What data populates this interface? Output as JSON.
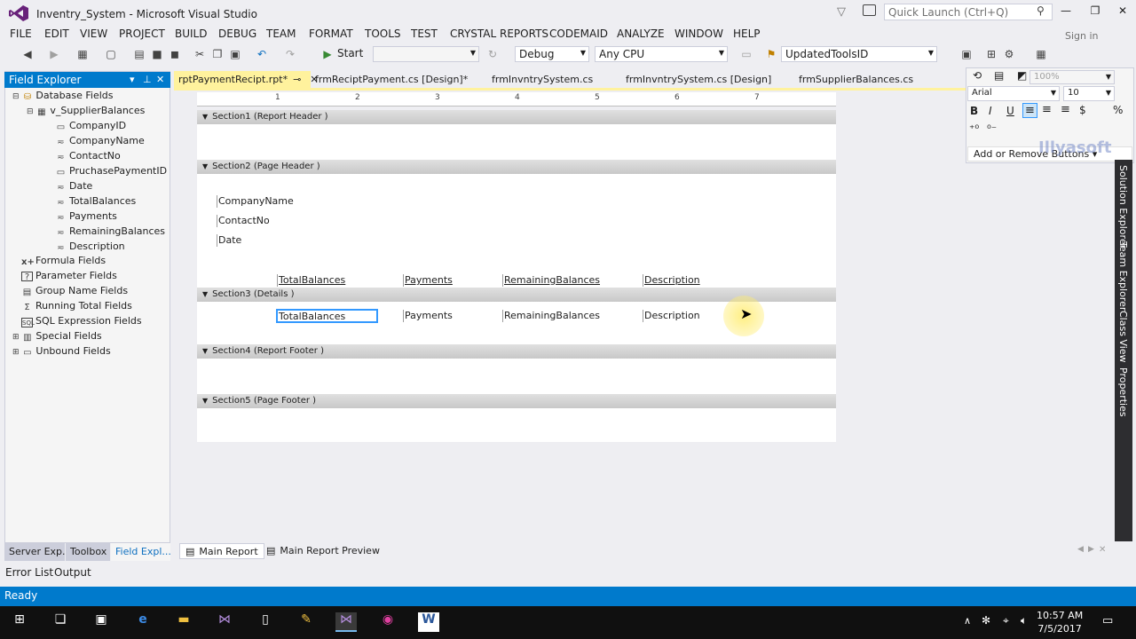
{
  "window": {
    "title": "Inventry_System - Microsoft Visual Studio",
    "quick_launch_placeholder": "Quick Launch (Ctrl+Q)"
  },
  "menu": [
    "FILE",
    "EDIT",
    "VIEW",
    "PROJECT",
    "BUILD",
    "DEBUG",
    "TEAM",
    "FORMAT",
    "TOOLS",
    "TEST",
    "CRYSTAL REPORTS",
    "CODEMAID",
    "ANALYZE",
    "WINDOW",
    "HELP"
  ],
  "toolbar": {
    "start_label": "Start",
    "config": "Debug",
    "platform": "Any CPU",
    "find_combo": "UpdatedToolsID"
  },
  "field_explorer": {
    "title": "Field Explorer",
    "database_fields": "Database Fields",
    "table": "v_SupplierBalances",
    "columns": [
      "CompanyID",
      "CompanyName",
      "ContactNo",
      "PruchasePaymentID",
      "Date",
      "TotalBalances",
      "Payments",
      "RemainingBalances",
      "Description"
    ],
    "groups": [
      "Formula Fields",
      "Parameter Fields",
      "Group Name Fields",
      "Running Total Fields",
      "SQL Expression Fields",
      "Special Fields",
      "Unbound Fields"
    ]
  },
  "left_tabs": [
    "Server Exp...",
    "Toolbox",
    "Field Expl..."
  ],
  "doc_tabs": [
    "rptPaymentRecipt.rpt*",
    "frmReciptPayment.cs [Design]*",
    "frmInvntrySystem.cs",
    "frmInvntrySystem.cs [Design]",
    "frmSupplierBalances.cs"
  ],
  "ruler_numbers": [
    "1",
    "2",
    "3",
    "4",
    "5",
    "6",
    "7"
  ],
  "sections": {
    "s1": "Section1 (Report Header )",
    "s2": "Section2 (Page Header )",
    "s3": "Section3 (Details )",
    "s4": "Section4 (Report Footer )",
    "s5": "Section5 (Page Footer )"
  },
  "page_header_fields": [
    "CompanyName",
    "ContactNo",
    "Date"
  ],
  "header_labels": [
    "TotalBalances",
    "Payments",
    "RemainingBalances",
    "Description"
  ],
  "detail_fields": [
    "TotalBalances",
    "Payments",
    "RemainingBalances",
    "Description"
  ],
  "format_bar": {
    "font": "Arial",
    "size": "10",
    "zoom": "100%",
    "bold": "B",
    "italic": "I",
    "underline": "U",
    "add_remove": "Add or Remove Buttons",
    "sign_in": "Sign in"
  },
  "right_tabs": [
    "Solution Explorer",
    "Team Explorer",
    "Class View",
    "Properties"
  ],
  "designer_tabs": [
    "Main Report",
    "Main Report Preview"
  ],
  "bottom_tabs": [
    "Error List",
    "Output"
  ],
  "status": "Ready",
  "clock": {
    "time": "10:57 AM",
    "date": "7/5/2017"
  },
  "watermark": "Illyasoft",
  "colors": {
    "accent": "#007ACC",
    "active_tab": "#FFF29D",
    "selection": "#3399FF"
  }
}
